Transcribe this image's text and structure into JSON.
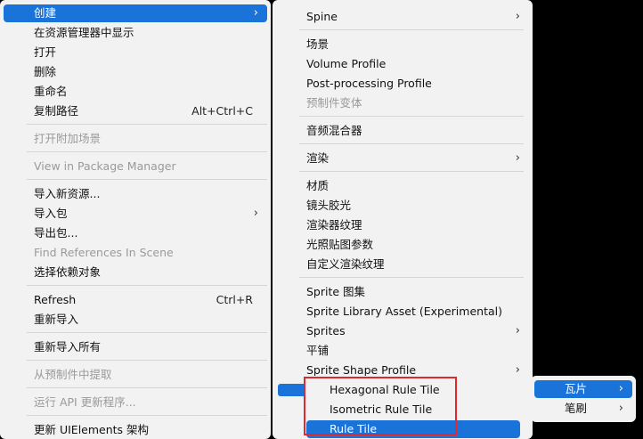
{
  "main_menu": {
    "items": [
      {
        "label": "创建",
        "arrow": "›",
        "highlight": true
      },
      {
        "label": "在资源管理器中显示"
      },
      {
        "label": "打开"
      },
      {
        "label": "删除"
      },
      {
        "label": "重命名"
      },
      {
        "label": "复制路径",
        "shortcut": "Alt+Ctrl+C"
      },
      {
        "label": "打开附加场景",
        "disabled": true
      },
      {
        "label": "View in Package Manager",
        "disabled": true
      },
      {
        "label": "导入新资源..."
      },
      {
        "label": "导入包",
        "arrow": "›"
      },
      {
        "label": "导出包..."
      },
      {
        "label": "Find References In Scene",
        "disabled": true
      },
      {
        "label": "选择依赖对象"
      },
      {
        "label": "Refresh",
        "shortcut": "Ctrl+R"
      },
      {
        "label": "重新导入"
      },
      {
        "label": "重新导入所有"
      },
      {
        "label": "从预制件中提取",
        "disabled": true
      },
      {
        "label": "运行 API 更新程序...",
        "disabled": true
      },
      {
        "label": "更新 UIElements 架构"
      }
    ]
  },
  "create_menu": {
    "items": [
      {
        "label": "Spine",
        "arrow": "›"
      },
      {
        "label": "场景"
      },
      {
        "label": "Volume Profile"
      },
      {
        "label": "Post-processing Profile"
      },
      {
        "label": "预制件变体",
        "disabled": true
      },
      {
        "label": "音频混合器"
      },
      {
        "label": "渲染",
        "arrow": "›"
      },
      {
        "label": "材质"
      },
      {
        "label": "镜头胶光"
      },
      {
        "label": "渲染器纹理"
      },
      {
        "label": "光照贴图参数"
      },
      {
        "label": "自定义渲染纹理"
      },
      {
        "label": "Sprite 图集"
      },
      {
        "label": "Sprite Library Asset (Experimental)"
      },
      {
        "label": "Sprites",
        "arrow": "›"
      },
      {
        "label": "平铺"
      },
      {
        "label": "Sprite Shape Profile",
        "arrow": "›"
      }
    ]
  },
  "tile_menu": {
    "items": [
      {
        "label": "瓦片",
        "arrow": "›",
        "highlight": true
      },
      {
        "label": "笔刷",
        "arrow": "›"
      }
    ]
  },
  "rule_tile_menu": {
    "items": [
      {
        "label": "Hexagonal Rule Tile"
      },
      {
        "label": "Isometric Rule Tile"
      },
      {
        "label": "Rule Tile",
        "highlight": true
      }
    ]
  },
  "colors": {
    "highlight": "#1a73d9",
    "menu_bg": "#f2f2f2",
    "disabled": "#9a9a9a",
    "annotation": "#e0282d"
  }
}
